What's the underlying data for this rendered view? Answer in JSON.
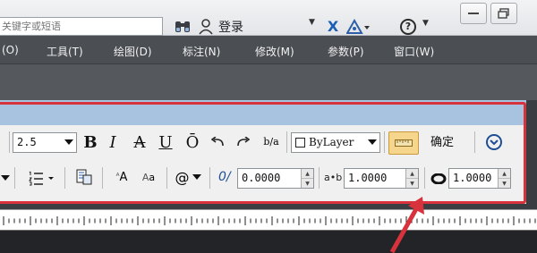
{
  "titlebar": {
    "search_placeholder": "关键字或短语",
    "login_label": "登录",
    "help_label": "?"
  },
  "menu": {
    "items": [
      "(O)",
      "工具(T)",
      "绘图(D)",
      "标注(N)",
      "修改(M)",
      "参数(P)",
      "窗口(W)"
    ]
  },
  "text_editor": {
    "text_height": "2.5",
    "format_buttons": [
      "B",
      "I",
      "A",
      "U",
      "Ō"
    ],
    "stack_label": "b/a",
    "color_value": "ByLayer",
    "confirm_label": "确定",
    "oblique_angle": "0.0000",
    "tracking": "1.0000",
    "width_factor": "1.0000",
    "tracking_glyph": "a•b"
  },
  "colors": {
    "accent_red": "#d8323c",
    "panel_header": "#a7c3e0",
    "menubar": "#4b4e53"
  }
}
